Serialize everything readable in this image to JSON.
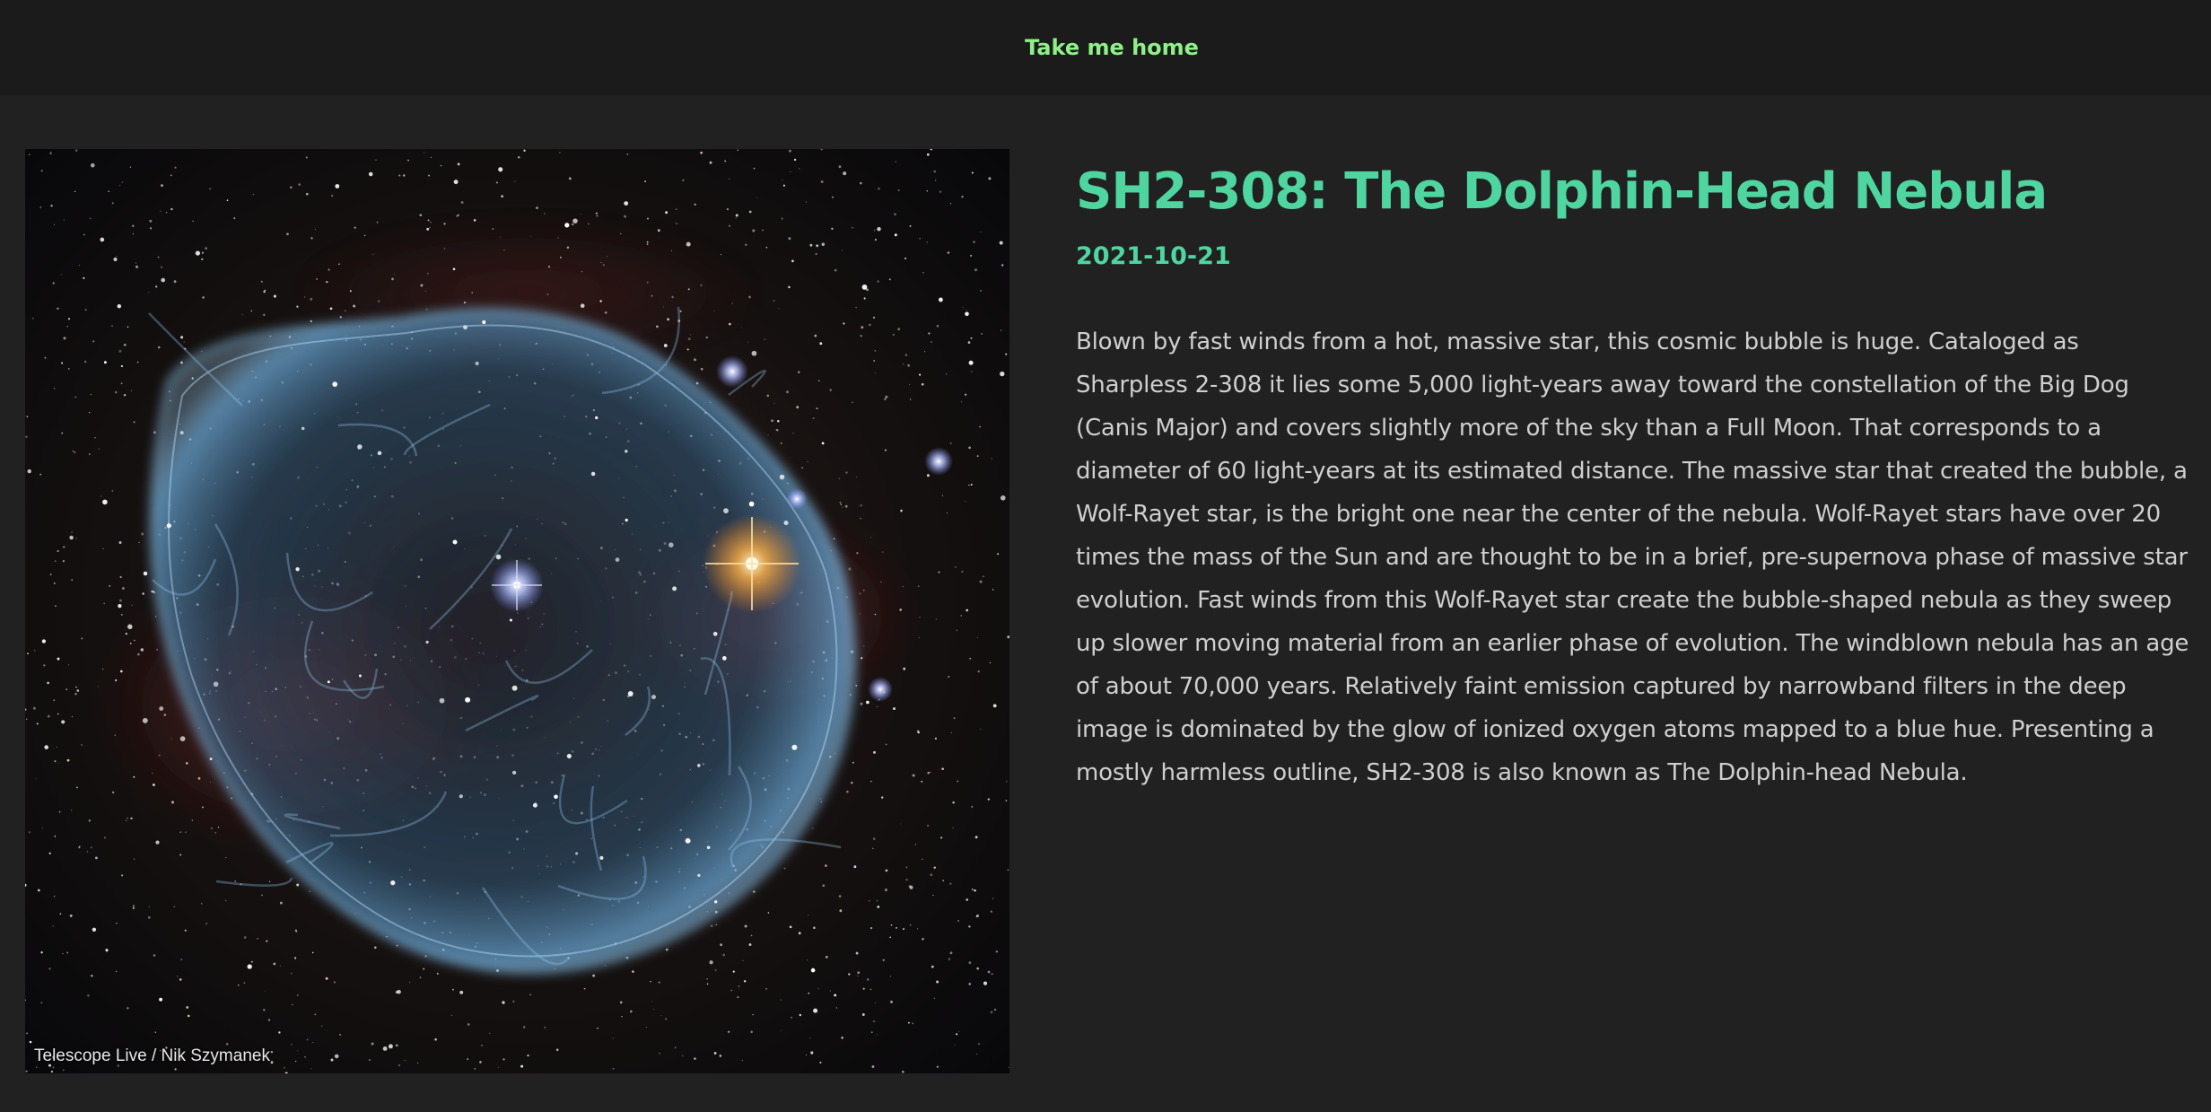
{
  "nav": {
    "home_label": "Take me home"
  },
  "apod": {
    "title": "SH2-308: The Dolphin-Head Nebula",
    "date": "2021-10-21",
    "explanation": "Blown by fast winds from a hot, massive star, this cosmic bubble is huge. Cataloged as Sharpless 2-308 it lies some 5,000 light-years away toward the constellation of the Big Dog (Canis Major) and covers slightly more of the sky than a Full Moon. That corresponds to a diameter of 60 light-years at its estimated distance. The massive star that created the bubble, a Wolf-Rayet star, is the bright one near the center of the nebula. Wolf-Rayet stars have over 20 times the mass of the Sun and are thought to be in a brief, pre-supernova phase of massive star evolution. Fast winds from this Wolf-Rayet star create the bubble-shaped nebula as they sweep up slower moving material from an earlier phase of evolution. The windblown nebula has an age of about 70,000 years. Relatively faint emission captured by narrowband filters in the deep image is dominated by the glow of ionized oxygen atoms mapped to a blue hue. Presenting a mostly harmless outline, SH2-308 is also known as The Dolphin-head Nebula.",
    "image_credit": "Telescope Live / Nik Szymanek"
  },
  "colors": {
    "page_bg": "#212121",
    "topbar_bg": "#1b1b1b",
    "home_link": "#8ff08a",
    "title": "#4fd6a0",
    "body_text": "#cfcfcf"
  }
}
